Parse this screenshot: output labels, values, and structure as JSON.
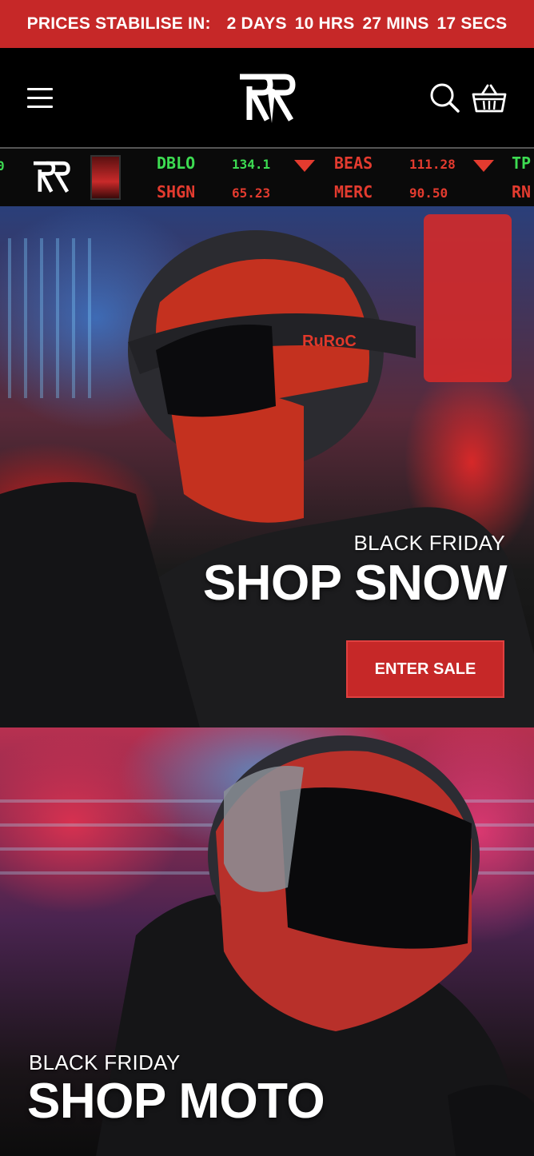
{
  "countdown": {
    "label": "PRICES STABILISE IN:",
    "days_value": "2",
    "days_unit": "DAYS",
    "hours_value": "10",
    "hours_unit": "HRS",
    "mins_value": "27",
    "mins_unit": "MINS",
    "secs_value": "17",
    "secs_unit": "SECS",
    "background": "#c62828"
  },
  "header": {
    "menu_icon": "hamburger-menu-icon",
    "logo_icon": "ruroc-rr-logo",
    "search_icon": "search-icon",
    "cart_icon": "basket-icon"
  },
  "ticker": {
    "row1": [
      {
        "symbol": "DBLO",
        "value": "134.1"
      },
      {
        "symbol": "BEAS",
        "value": "111.28"
      },
      {
        "symbol": "TP",
        "value": ""
      }
    ],
    "row2": [
      {
        "symbol": "SHGN",
        "value": "65.23"
      },
      {
        "symbol": "MERC",
        "value": "90.50"
      },
      {
        "symbol": "RN",
        "value": ""
      }
    ],
    "colors": {
      "up": "#3ddc52",
      "down": "#e33b2f"
    }
  },
  "hero_snow": {
    "eyebrow": "BLACK FRIDAY",
    "headline": "SHOP SNOW",
    "cta_label": "ENTER SALE",
    "helmet_brand": "RuRoC"
  },
  "hero_moto": {
    "eyebrow": "BLACK FRIDAY",
    "headline": "SHOP MOTO"
  },
  "accent": "#c62828"
}
